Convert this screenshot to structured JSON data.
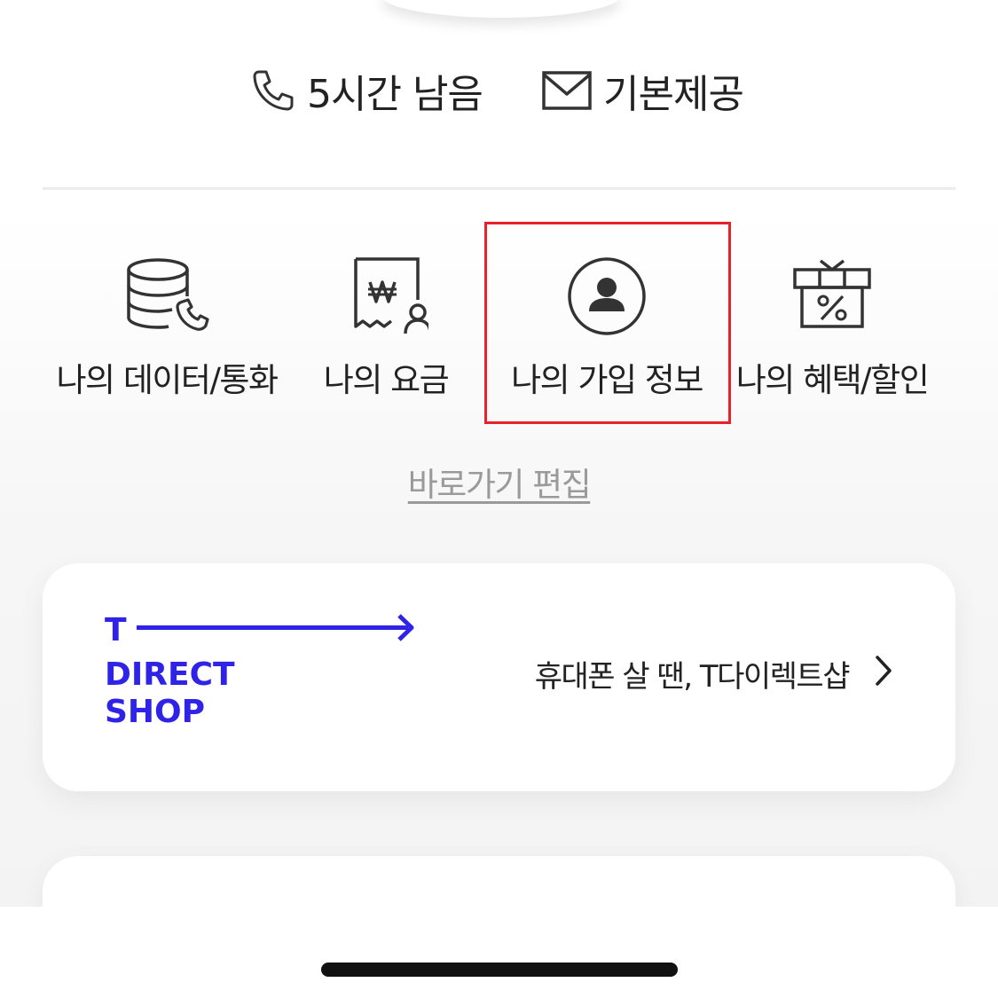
{
  "usage": {
    "call_remaining": "5시간 남음",
    "message": "기본제공"
  },
  "shortcuts": [
    {
      "label": "나의 데이터/통화",
      "icon": "database-phone-icon"
    },
    {
      "label": "나의 요금",
      "icon": "won-receipt-icon"
    },
    {
      "label": "나의 가입 정보",
      "icon": "user-circle-icon"
    },
    {
      "label": "나의 혜택/할인",
      "icon": "gift-percent-icon"
    }
  ],
  "edit_shortcuts_label": "바로가기 편집",
  "tdirect_card": {
    "logo_lines": [
      "T",
      "DIRECT",
      "SHOP"
    ],
    "text": "휴대폰 살 땐, T다이렉트샵",
    "brand_color": "#2f23e8"
  },
  "colors": {
    "highlight": "#e8222a",
    "text": "#222222",
    "muted": "#9a9a9a"
  }
}
